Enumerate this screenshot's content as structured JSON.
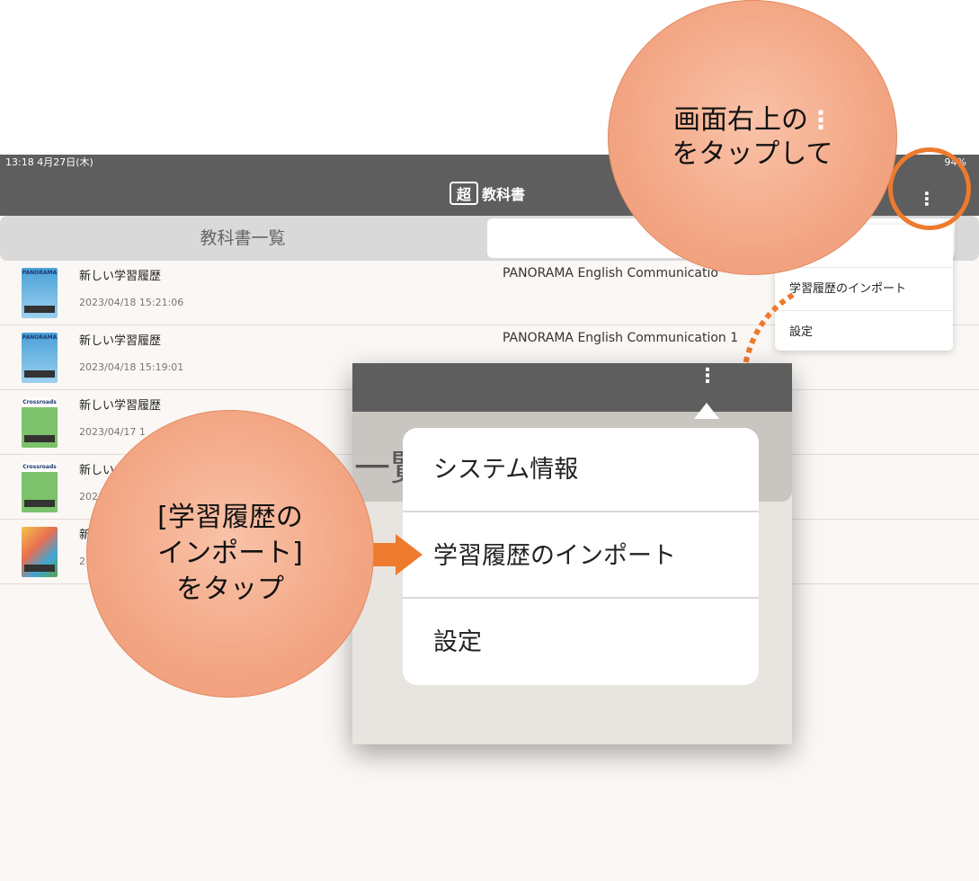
{
  "status": {
    "time": "13:18  4月27日(木)",
    "battery": "94%"
  },
  "navbar": {
    "logo_mark": "超",
    "logo_text": "教科書",
    "more_icon": "⋮"
  },
  "tabs": {
    "left_label": "教科書一覧"
  },
  "list": [
    {
      "title": "新しい学習履歴",
      "date": "2023/04/18 15:21:06",
      "book": "PANORAMA English Communicatio",
      "thumb": "PANORAMA"
    },
    {
      "title": "新しい学習履歴",
      "date": "2023/04/18 15:19:01",
      "book": "PANORAMA English Communication 1",
      "thumb": "PANORAMA"
    },
    {
      "title": "新しい学習履歴",
      "date": "2023/04/17 1",
      "book": "",
      "thumb": "Crossroads"
    },
    {
      "title": "新しい",
      "date": "202",
      "book": "",
      "thumb": "Crossroads"
    },
    {
      "title": "新",
      "date": "2",
      "book": "",
      "thumb": ""
    }
  ],
  "menu_small": {
    "item1": "情報",
    "item2": "学習履歴のインポート",
    "item3": "設定"
  },
  "callouts": {
    "top_line1": "画面右上の",
    "top_line2": "をタップして",
    "left_line1": "[学習履歴の",
    "left_line2": "インポート]",
    "left_line3": "をタップ"
  },
  "zoom": {
    "tab_char": "一覧",
    "more_icon": "⋮",
    "item1": "システム情報",
    "item2": "学習履歴のインポート",
    "item3": "設定"
  },
  "colors": {
    "accent": "#ee7a2e",
    "callout": "#f3a684",
    "bar": "#5e5e5e"
  }
}
